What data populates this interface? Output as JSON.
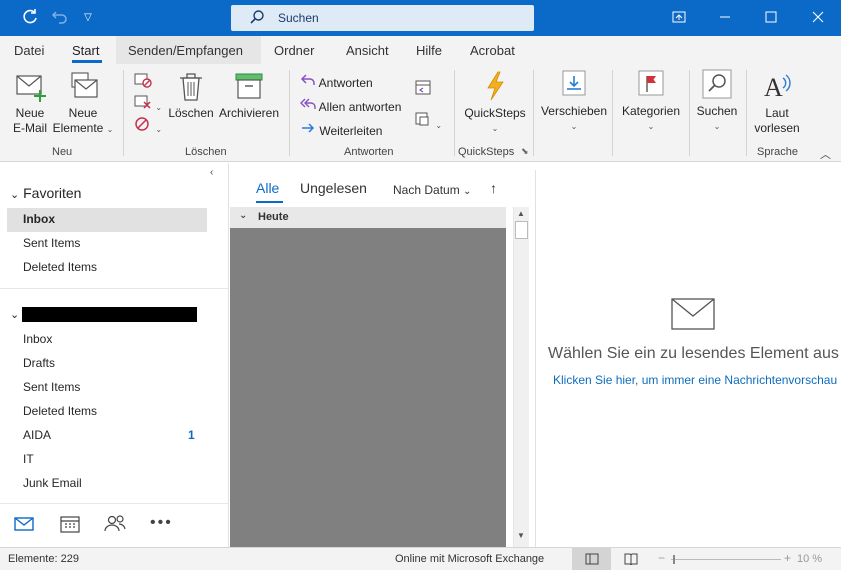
{
  "titlebar": {
    "search_placeholder": "Suchen",
    "buttons": [
      "sync",
      "undo",
      "customize",
      "ribbon-display",
      "minimize",
      "maximize",
      "close"
    ]
  },
  "menu": {
    "tabs": [
      "Datei",
      "Start",
      "Senden/Empfangen",
      "Ordner",
      "Ansicht",
      "Hilfe",
      "Acrobat"
    ],
    "active": "Start"
  },
  "ribbon": {
    "neu": {
      "label": "Neu",
      "new_email_line1": "Neue",
      "new_email_line2": "E-Mail",
      "new_items_line1": "Neue",
      "new_items_line2": "Elemente"
    },
    "loeschen": {
      "label": "Löschen",
      "delete": "Löschen",
      "archive": "Archivieren"
    },
    "antworten": {
      "label": "Antworten",
      "reply": "Antworten",
      "reply_all": "Allen antworten",
      "forward": "Weiterleiten"
    },
    "quicksteps": {
      "label": "QuickSteps",
      "button": "QuickSteps"
    },
    "move": {
      "button": "Verschieben"
    },
    "tags": {
      "button": "Kategorien"
    },
    "find": {
      "button": "Suchen"
    },
    "sprache": {
      "label": "Sprache",
      "line1": "Laut",
      "line2": "vorlesen"
    }
  },
  "folders": {
    "favorites_label": "Favoriten",
    "favorites": [
      "Inbox",
      "Sent Items",
      "Deleted Items"
    ],
    "account_items": [
      {
        "name": "Inbox",
        "count": ""
      },
      {
        "name": "Drafts",
        "count": ""
      },
      {
        "name": "Sent Items",
        "count": ""
      },
      {
        "name": "Deleted Items",
        "count": ""
      },
      {
        "name": "AIDA",
        "count": "1"
      },
      {
        "name": "IT",
        "count": ""
      },
      {
        "name": "Junk Email",
        "count": ""
      }
    ]
  },
  "msglist": {
    "tab_all": "Alle",
    "tab_unread": "Ungelesen",
    "sort": "Nach Datum",
    "group_today": "Heute"
  },
  "reading": {
    "message": "Wählen Sie ein zu lesendes Element aus",
    "link": "Klicken Sie hier, um immer eine Nachrichtenvorschau anzuzeigen"
  },
  "status": {
    "items": "Elemente: 229",
    "connection": "Online mit Microsoft Exchange",
    "zoom": "10 %"
  },
  "colors": {
    "accent": "#0b6ac7",
    "link": "#0f6cbd"
  }
}
